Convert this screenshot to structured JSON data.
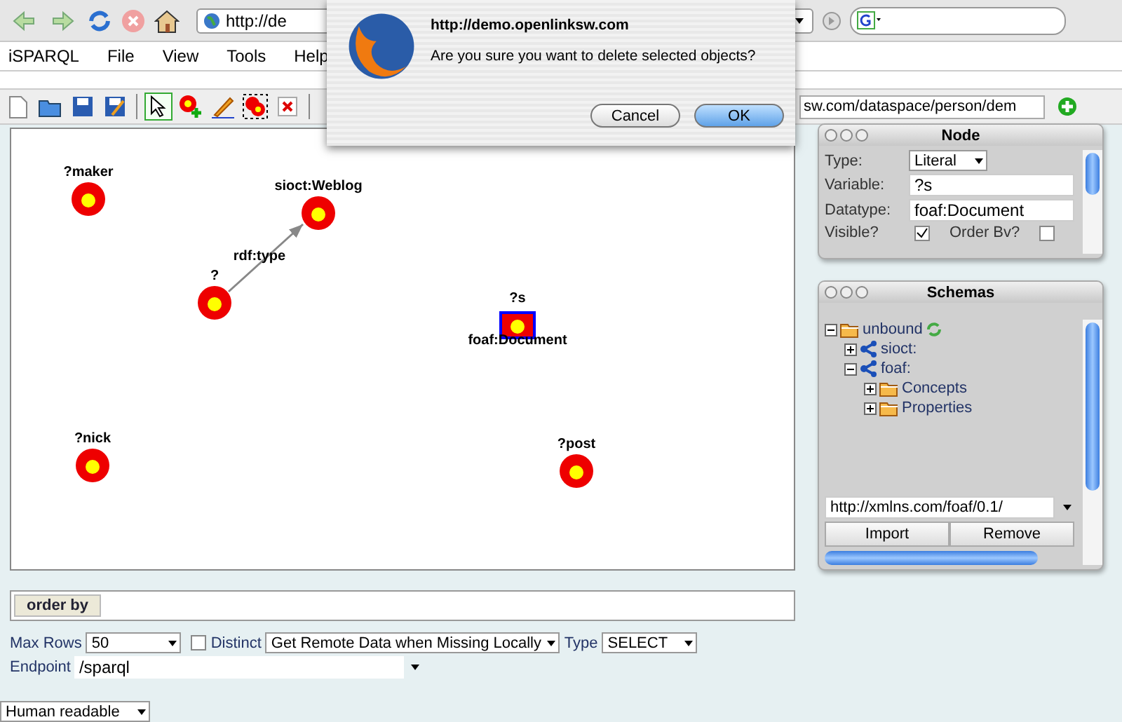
{
  "browser": {
    "url": "http://de"
  },
  "menu": [
    "iSPARQL",
    "File",
    "View",
    "Tools",
    "Help"
  ],
  "toolbar": {
    "endpoint_value": "sw.com/dataspace/person/dem"
  },
  "canvas": {
    "nodes": [
      {
        "label": "?maker",
        "kind": "variable",
        "selected": false
      },
      {
        "label": "sioct:Weblog",
        "kind": "variable",
        "selected": false
      },
      {
        "label": "?",
        "kind": "variable",
        "selected": false
      },
      {
        "label": "?s",
        "kind": "literal",
        "selected": true,
        "datatype": "foaf:Document"
      },
      {
        "label": "?nick",
        "kind": "variable",
        "selected": false
      },
      {
        "label": "?post",
        "kind": "variable",
        "selected": false
      }
    ],
    "edges": [
      {
        "label": "rdf:type"
      }
    ]
  },
  "node_panel": {
    "title": "Node",
    "type_label": "Type:",
    "type_value": "Literal",
    "variable_label": "Variable:",
    "variable_value": "?s",
    "datatype_label": "Datatype:",
    "datatype_value": "foaf:Document",
    "visible_label": "Visible?",
    "visible": true,
    "order_by_label": "Order Bv?",
    "order_by": false
  },
  "schemas_panel": {
    "title": "Schemas",
    "tree": [
      {
        "label": "unbound",
        "kind": "folder",
        "expanded": true,
        "children": [
          {
            "label": "sioct:",
            "kind": "schema",
            "expanded": false
          },
          {
            "label": "foaf:",
            "kind": "schema",
            "expanded": true,
            "children": [
              {
                "label": "Concepts",
                "kind": "folder",
                "expanded": false
              },
              {
                "label": "Properties",
                "kind": "folder",
                "expanded": false
              }
            ]
          }
        ]
      }
    ],
    "url": "http://xmlns.com/foaf/0.1/",
    "buttons": [
      "Import",
      "Remove"
    ]
  },
  "order_by": {
    "label": "order by"
  },
  "options": {
    "max_rows_label": "Max Rows",
    "max_rows": "50",
    "distinct_label": "Distinct",
    "distinct": false,
    "remote": "Get Remote Data when Missing Locally",
    "type_label": "Type",
    "type": "SELECT",
    "endpoint_label": "Endpoint",
    "endpoint": "/sparql"
  },
  "output_format": "Human readable",
  "dialog": {
    "title": "http://demo.openlinksw.com",
    "message": "Are you sure you want to delete selected objects?",
    "buttons": [
      {
        "label": "Cancel",
        "default": false
      },
      {
        "label": "OK",
        "default": true
      }
    ]
  }
}
